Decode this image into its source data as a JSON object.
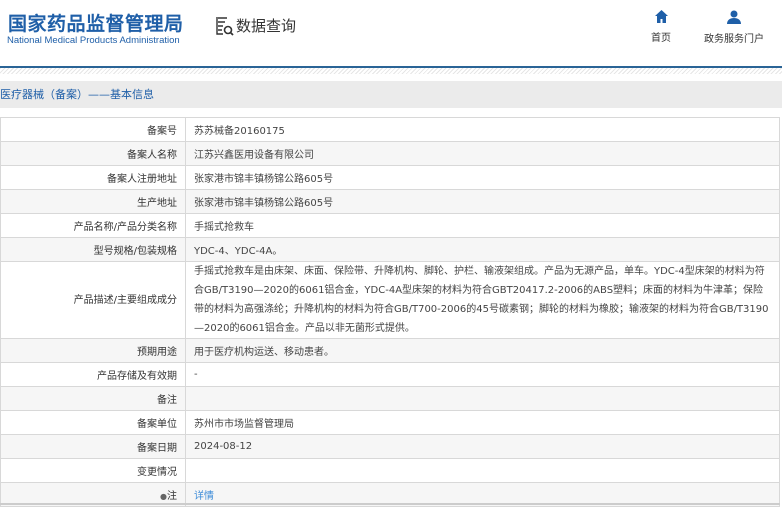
{
  "header": {
    "logo_cn": "国家药品监督管理局",
    "logo_en": "National Medical Products Administration",
    "section": "数据查询",
    "nav": [
      {
        "label": "首页",
        "icon": "home-icon"
      },
      {
        "label": "政务服务门户",
        "icon": "user-icon"
      }
    ]
  },
  "breadcrumb": "医疗器械（备案）——基本信息",
  "rows": [
    {
      "label": "备案号",
      "value": "苏苏械备20160175"
    },
    {
      "label": "备案人名称",
      "value": "江苏兴鑫医用设备有限公司"
    },
    {
      "label": "备案人注册地址",
      "value": "张家港市锦丰镇杨锦公路605号"
    },
    {
      "label": "生产地址",
      "value": "张家港市锦丰镇杨锦公路605号"
    },
    {
      "label": "产品名称/产品分类名称",
      "value": "手摇式抢救车"
    },
    {
      "label": "型号规格/包装规格",
      "value": "YDC-4、YDC-4A。"
    },
    {
      "label": "产品描述/主要组成成分",
      "value": "手摇式抢救车是由床架、床面、保险带、升降机构、脚轮、护栏、输液架组成。产品为无源产品，单车。YDC-4型床架的材料为符合GB/T3190—2020的6061铝合金，YDC-4A型床架的材料为符合GBT20417.2-2006的ABS塑料；床面的材料为牛津革；保险带的材料为高强涤纶；升降机构的材料为符合GB/T700-2006的45号碳素钢；脚轮的材料为橡胶；输液架的材料为符合GB/T3190—2020的6061铝合金。产品以非无菌形式提供。"
    },
    {
      "label": "预期用途",
      "value": "用于医疗机构运送、移动患者。"
    },
    {
      "label": "产品存储及有效期",
      "value": "-"
    },
    {
      "label": "备注",
      "value": ""
    },
    {
      "label": "备案单位",
      "value": "苏州市市场监督管理局"
    },
    {
      "label": "备案日期",
      "value": "2024-08-12"
    },
    {
      "label": "变更情况",
      "value": ""
    },
    {
      "label": "注",
      "value": "详情"
    }
  ]
}
